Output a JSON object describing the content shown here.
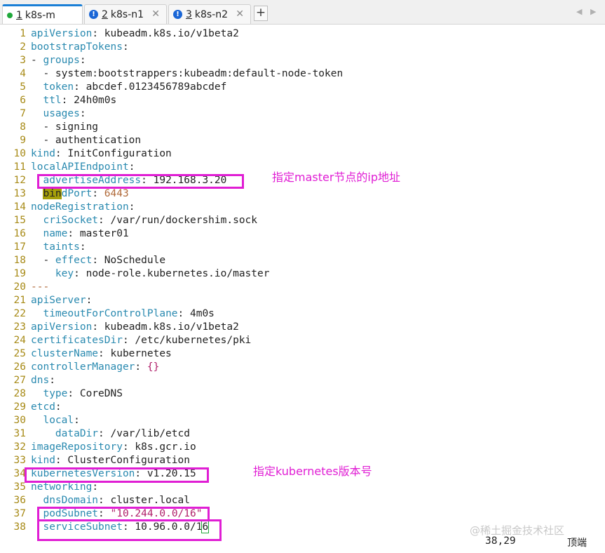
{
  "tabs": [
    {
      "num": "1",
      "label": "k8s-m",
      "status": "connected"
    },
    {
      "num": "2",
      "label": "k8s-n1",
      "status": "warning"
    },
    {
      "num": "3",
      "label": "k8s-n2",
      "status": "warning"
    }
  ],
  "add_tab_label": "+",
  "lines": [
    {
      "n": "1",
      "segs": [
        [
          "k",
          "apiVersion"
        ],
        [
          "v",
          ": kubeadm.k8s.io/v1beta2"
        ]
      ]
    },
    {
      "n": "2",
      "segs": [
        [
          "k",
          "bootstrapTokens"
        ],
        [
          "v",
          ":"
        ]
      ]
    },
    {
      "n": "3",
      "segs": [
        [
          "v",
          "- "
        ],
        [
          "k",
          "groups"
        ],
        [
          "v",
          ":"
        ]
      ]
    },
    {
      "n": "4",
      "segs": [
        [
          "v",
          "  - system:bootstrappers:kubeadm:default-node-token"
        ]
      ]
    },
    {
      "n": "5",
      "segs": [
        [
          "v",
          "  "
        ],
        [
          "k",
          "token"
        ],
        [
          "v",
          ": abcdef.0123456789abcdef"
        ]
      ]
    },
    {
      "n": "6",
      "segs": [
        [
          "v",
          "  "
        ],
        [
          "k",
          "ttl"
        ],
        [
          "v",
          ": 24h0m0s"
        ]
      ]
    },
    {
      "n": "7",
      "segs": [
        [
          "v",
          "  "
        ],
        [
          "k",
          "usages"
        ],
        [
          "v",
          ":"
        ]
      ]
    },
    {
      "n": "8",
      "segs": [
        [
          "v",
          "  - signing"
        ]
      ]
    },
    {
      "n": "9",
      "segs": [
        [
          "v",
          "  - authentication"
        ]
      ]
    },
    {
      "n": "10",
      "segs": [
        [
          "k",
          "kind"
        ],
        [
          "v",
          ": InitConfiguration"
        ]
      ]
    },
    {
      "n": "11",
      "segs": [
        [
          "k",
          "localAPIEndpoint"
        ],
        [
          "v",
          ":"
        ]
      ]
    },
    {
      "n": "12",
      "segs": [
        [
          "v",
          "  "
        ],
        [
          "k",
          "advertiseAddress"
        ],
        [
          "v",
          ": 192.168.3.20"
        ]
      ]
    },
    {
      "n": "13",
      "segs": [
        [
          "v",
          "  "
        ],
        [
          "hl",
          "bin"
        ],
        [
          "k",
          "dPort"
        ],
        [
          "v",
          ": "
        ],
        [
          "n",
          "6443"
        ]
      ]
    },
    {
      "n": "14",
      "segs": [
        [
          "k",
          "nodeRegistration"
        ],
        [
          "v",
          ":"
        ]
      ]
    },
    {
      "n": "15",
      "segs": [
        [
          "v",
          "  "
        ],
        [
          "k",
          "criSocket"
        ],
        [
          "v",
          ": /var/run/dockershim.sock"
        ]
      ]
    },
    {
      "n": "16",
      "segs": [
        [
          "v",
          "  "
        ],
        [
          "k",
          "name"
        ],
        [
          "v",
          ": master01"
        ]
      ]
    },
    {
      "n": "17",
      "segs": [
        [
          "v",
          "  "
        ],
        [
          "k",
          "taints"
        ],
        [
          "v",
          ":"
        ]
      ]
    },
    {
      "n": "18",
      "segs": [
        [
          "v",
          "  - "
        ],
        [
          "k",
          "effect"
        ],
        [
          "v",
          ": NoSchedule"
        ]
      ]
    },
    {
      "n": "19",
      "segs": [
        [
          "v",
          "    "
        ],
        [
          "k",
          "key"
        ],
        [
          "v",
          ": node-role.kubernetes.io/master"
        ]
      ]
    },
    {
      "n": "20",
      "segs": [
        [
          "n",
          "---"
        ]
      ]
    },
    {
      "n": "21",
      "segs": [
        [
          "k",
          "apiServer"
        ],
        [
          "v",
          ":"
        ]
      ]
    },
    {
      "n": "22",
      "segs": [
        [
          "v",
          "  "
        ],
        [
          "k",
          "timeoutForControlPlane"
        ],
        [
          "v",
          ": 4m0s"
        ]
      ]
    },
    {
      "n": "23",
      "segs": [
        [
          "k",
          "apiVersion"
        ],
        [
          "v",
          ": kubeadm.k8s.io/v1beta2"
        ]
      ]
    },
    {
      "n": "24",
      "segs": [
        [
          "k",
          "certificatesDir"
        ],
        [
          "v",
          ": /etc/kubernetes/pki"
        ]
      ]
    },
    {
      "n": "25",
      "segs": [
        [
          "k",
          "clusterName"
        ],
        [
          "v",
          ": kubernetes"
        ]
      ]
    },
    {
      "n": "26",
      "segs": [
        [
          "k",
          "controllerManager"
        ],
        [
          "v",
          ": "
        ],
        [
          "s",
          "{}"
        ]
      ]
    },
    {
      "n": "27",
      "segs": [
        [
          "k",
          "dns"
        ],
        [
          "v",
          ":"
        ]
      ]
    },
    {
      "n": "28",
      "segs": [
        [
          "v",
          "  "
        ],
        [
          "k",
          "type"
        ],
        [
          "v",
          ": CoreDNS"
        ]
      ]
    },
    {
      "n": "29",
      "segs": [
        [
          "k",
          "etcd"
        ],
        [
          "v",
          ":"
        ]
      ]
    },
    {
      "n": "30",
      "segs": [
        [
          "v",
          "  "
        ],
        [
          "k",
          "local"
        ],
        [
          "v",
          ":"
        ]
      ]
    },
    {
      "n": "31",
      "segs": [
        [
          "v",
          "    "
        ],
        [
          "k",
          "dataDir"
        ],
        [
          "v",
          ": /var/lib/etcd"
        ]
      ]
    },
    {
      "n": "32",
      "segs": [
        [
          "k",
          "imageRepository"
        ],
        [
          "v",
          ": k8s.gcr.io"
        ]
      ]
    },
    {
      "n": "33",
      "segs": [
        [
          "k",
          "kind"
        ],
        [
          "v",
          ": ClusterConfiguration"
        ]
      ]
    },
    {
      "n": "34",
      "segs": [
        [
          "k",
          "kubernetesVersion"
        ],
        [
          "v",
          ": v1.20.15"
        ]
      ]
    },
    {
      "n": "35",
      "segs": [
        [
          "k",
          "networking"
        ],
        [
          "v",
          ":"
        ]
      ]
    },
    {
      "n": "36",
      "segs": [
        [
          "v",
          "  "
        ],
        [
          "k",
          "dnsDomain"
        ],
        [
          "v",
          ": cluster.local"
        ]
      ]
    },
    {
      "n": "37",
      "segs": [
        [
          "v",
          "  "
        ],
        [
          "k",
          "podSubnet"
        ],
        [
          "v",
          ": "
        ],
        [
          "s",
          "\"10.244.0.0/16\""
        ]
      ]
    },
    {
      "n": "38",
      "segs": [
        [
          "v",
          "  "
        ],
        [
          "k",
          "serviceSubnet"
        ],
        [
          "v",
          ": 10.96.0.0/1"
        ],
        [
          "cur",
          "6"
        ]
      ]
    }
  ],
  "annotations": {
    "master_ip": "指定master节点的ip地址",
    "k8s_version": "指定kubernetes版本号"
  },
  "status": {
    "position": "38,29",
    "scroll": "顶端"
  },
  "watermark": "@稀土掘金技术社区",
  "colors": {
    "key": "#2a8ab0",
    "string": "#b0206a",
    "number": "#b06a3a",
    "line_number": "#a88b18",
    "annotation": "#e01ed4",
    "tab_active": "#1a7fd6"
  }
}
